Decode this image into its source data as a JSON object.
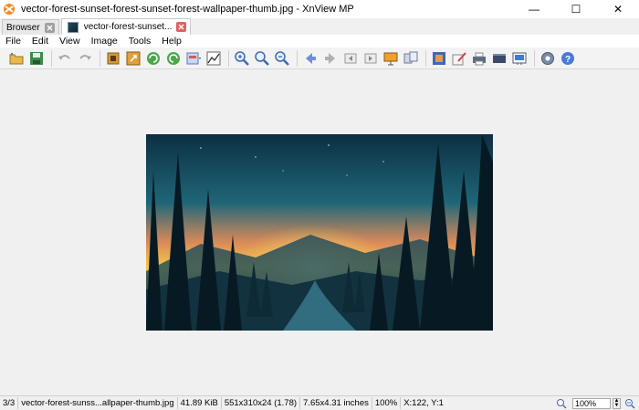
{
  "window": {
    "title": "vector-forest-sunset-forest-sunset-forest-wallpaper-thumb.jpg - XnView MP",
    "minimize": "—",
    "maximize": "☐",
    "close": "✕"
  },
  "tabs": [
    {
      "label": "Browser",
      "active": false
    },
    {
      "label": "vector-forest-sunset...",
      "active": true
    }
  ],
  "menu": [
    "File",
    "Edit",
    "View",
    "Image",
    "Tools",
    "Help"
  ],
  "toolbar": {
    "icons": [
      "open-folder-icon",
      "save-icon",
      "undo-icon",
      "redo-icon",
      "crop-icon",
      "resize-icon",
      "rotate-left-icon",
      "rotate-right-icon",
      "adjust-icon",
      "histogram-icon",
      "zoom-in-icon",
      "zoom-fit-icon",
      "zoom-out-icon",
      "previous-icon",
      "next-icon",
      "first-icon",
      "last-icon",
      "slideshow-icon",
      "compare-icon",
      "fullscreen-icon",
      "edit-icon",
      "print-icon",
      "scanner-icon",
      "wallpaper-icon",
      "settings-icon",
      "help-icon"
    ]
  },
  "status": {
    "index": "3/3",
    "filename": "vector-forest-sunss...allpaper-thumb.jpg",
    "filesize": "41.89 KiB",
    "dimensions": "551x310x24 (1.78)",
    "print_size": "7.65x4.31 inches",
    "zoom": "100%",
    "cursor": "X:122, Y:1",
    "zoom_field": "100%"
  },
  "colors": {
    "accent_blue": "#3d7bd6",
    "viewer_bg": "#f0f0f0"
  }
}
